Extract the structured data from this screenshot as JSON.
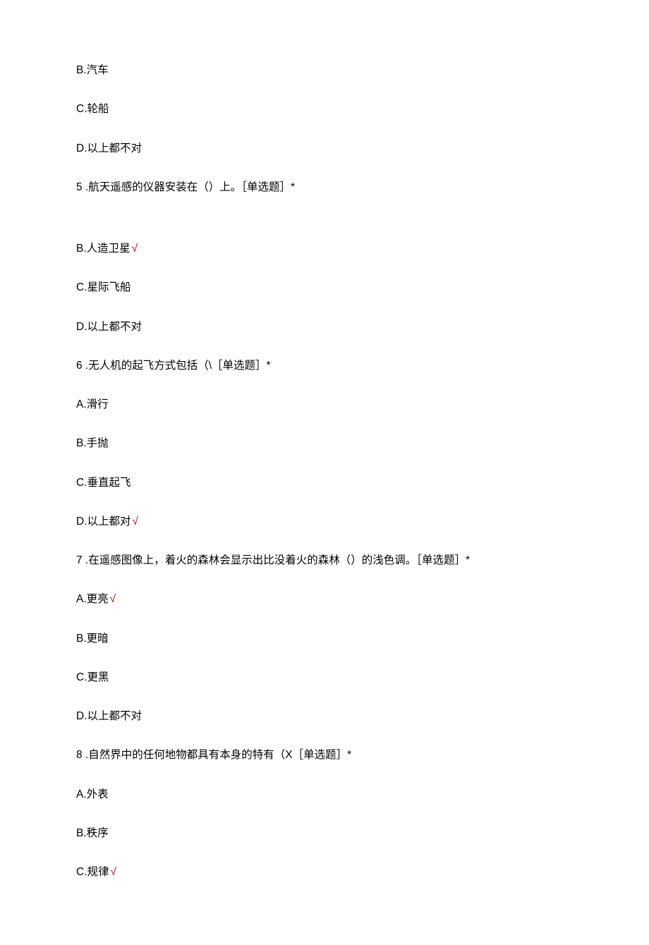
{
  "questions": [
    {
      "id": "q4_partial",
      "stem": null,
      "options": [
        {
          "letter": "B.",
          "text": "汽车",
          "correct": false
        },
        {
          "letter": "C.",
          "text": "轮船",
          "correct": false
        },
        {
          "letter": "D.",
          "text": "以上都不对",
          "correct": false
        }
      ]
    },
    {
      "id": "q5",
      "num": "5",
      "stem_prefix": "  .",
      "stem": "航天遥感的仪器安装在（）上。［单选题］*",
      "options": [
        {
          "letter": "B.",
          "text": "人造卫星",
          "correct": true
        },
        {
          "letter": "C.",
          "text": "星际飞船",
          "correct": false
        },
        {
          "letter": "D.",
          "text": "以上都不对",
          "correct": false
        }
      ],
      "has_blank_after_stem": true
    },
    {
      "id": "q6",
      "num": "6",
      "stem_prefix": "  .",
      "stem": "无人机的起飞方式包括（\\［单选题］*",
      "options": [
        {
          "letter": "A.",
          "text": "滑行",
          "correct": false
        },
        {
          "letter": "B.",
          "text": "手抛",
          "correct": false
        },
        {
          "letter": "C.",
          "text": "垂直起飞",
          "correct": false
        },
        {
          "letter": "D.",
          "text": "以上都对",
          "correct": true
        }
      ]
    },
    {
      "id": "q7",
      "num": "7",
      "stem_prefix": "  .",
      "stem": "在遥感图像上，着火的森林会显示出比没着火的森林（）的浅色调。［单选题］*",
      "options": [
        {
          "letter": "A.",
          "text": "更亮",
          "correct": true
        },
        {
          "letter": "B.",
          "text": "更暗",
          "correct": false
        },
        {
          "letter": "C.",
          "text": "更黑",
          "correct": false
        },
        {
          "letter": "D.",
          "text": "以上都不对",
          "correct": false
        }
      ]
    },
    {
      "id": "q8",
      "num": "8",
      "stem_prefix": "  .",
      "stem": "自然界中的任何地物都具有本身的特有（X［单选题］*",
      "options": [
        {
          "letter": "A.",
          "text": "外表",
          "correct": false
        },
        {
          "letter": "B.",
          "text": "秩序",
          "correct": false
        },
        {
          "letter": "C.",
          "text": "规律",
          "correct": true
        }
      ]
    }
  ],
  "check_mark": "√"
}
